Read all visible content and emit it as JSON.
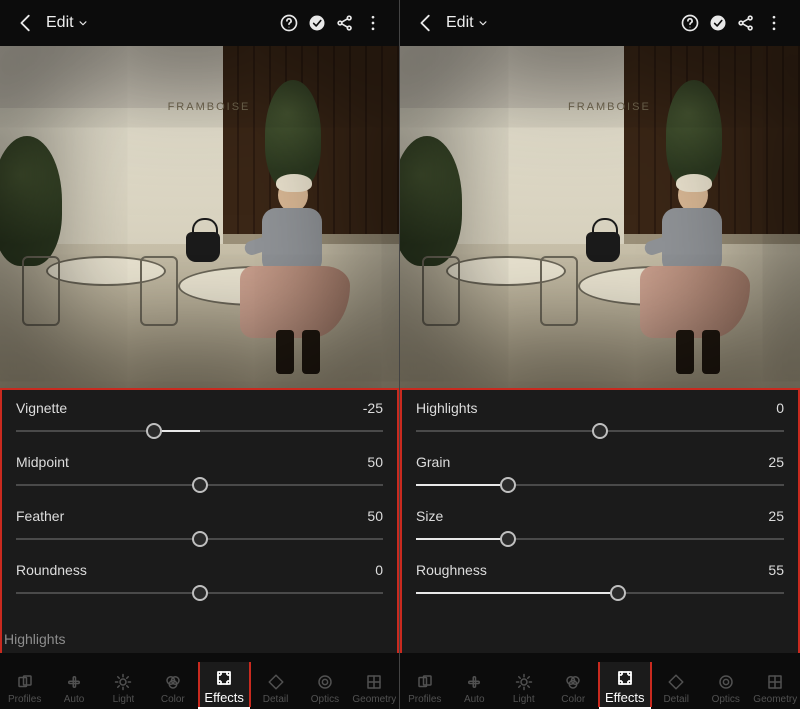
{
  "header": {
    "edit_label": "Edit"
  },
  "photo": {
    "sign": "FRAMBOISE"
  },
  "left": {
    "sliders": [
      {
        "label": "Vignette",
        "value": -25,
        "min": -100,
        "max": 100,
        "fill": "from-center"
      },
      {
        "label": "Midpoint",
        "value": 50,
        "min": 0,
        "max": 100,
        "fill": "none"
      },
      {
        "label": "Feather",
        "value": 50,
        "min": 0,
        "max": 100,
        "fill": "none"
      },
      {
        "label": "Roundness",
        "value": 0,
        "min": -100,
        "max": 100,
        "fill": "none"
      }
    ],
    "peek_next": "Highlights",
    "vignette_applied": true
  },
  "right": {
    "sliders": [
      {
        "label": "Highlights",
        "value": 0,
        "min": -100,
        "max": 100,
        "fill": "none"
      },
      {
        "label": "Grain",
        "value": 25,
        "min": 0,
        "max": 100,
        "fill": "from-left"
      },
      {
        "label": "Size",
        "value": 25,
        "min": 0,
        "max": 100,
        "fill": "from-left"
      },
      {
        "label": "Roughness",
        "value": 55,
        "min": 0,
        "max": 100,
        "fill": "from-left"
      }
    ],
    "peek_next": "",
    "vignette_applied": true
  },
  "nav": {
    "items": [
      {
        "label": "Profiles",
        "icon": "profiles"
      },
      {
        "label": "Auto",
        "icon": "auto"
      },
      {
        "label": "Light",
        "icon": "light"
      },
      {
        "label": "Color",
        "icon": "color"
      },
      {
        "label": "Effects",
        "icon": "effects"
      },
      {
        "label": "Detail",
        "icon": "detail"
      },
      {
        "label": "Optics",
        "icon": "optics"
      },
      {
        "label": "Geometry",
        "icon": "geometry"
      }
    ],
    "active_index": 4
  }
}
